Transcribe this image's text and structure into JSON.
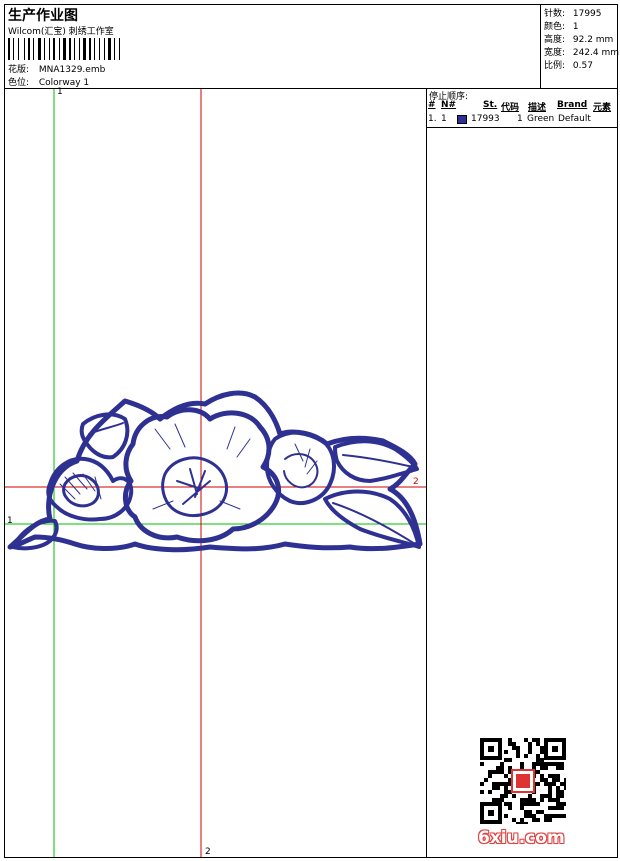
{
  "header": {
    "title": "生产作业图",
    "subtitle": "Wilcom(汇宝) 刺绣工作室",
    "design_label": "花版:",
    "design_value": "MNA1329.emb",
    "colorway_label": "色位:",
    "colorway_value": "Colorway 1"
  },
  "stats": {
    "stitches_label": "针数:",
    "stitches_value": "17995",
    "colors_label": "颜色:",
    "colors_value": "1",
    "height_label": "高度:",
    "height_value": "92.2 mm",
    "width_label": "宽度:",
    "width_value": "242.4 mm",
    "scale_label": "比例:",
    "scale_value": "0.57"
  },
  "stop_sequence": {
    "title": "停止顺序:",
    "columns": [
      "#",
      "N#",
      "St.",
      "代码",
      "描述",
      "Brand",
      "元素"
    ],
    "rows": [
      {
        "num": "1.",
        "n": "1",
        "swatch_color": "#2e3192",
        "stitches": "17993",
        "code": "1",
        "description": "Green",
        "brand": "Default"
      }
    ]
  },
  "guides": {
    "v_green_label": "1",
    "h_green_label": "1",
    "h_red_label": "2",
    "v_red_label": "2"
  },
  "colors": {
    "embroidery": "#2e3192",
    "guide_green": "#00c000",
    "guide_red": "#d00000",
    "watermark": "6xiu.com"
  }
}
